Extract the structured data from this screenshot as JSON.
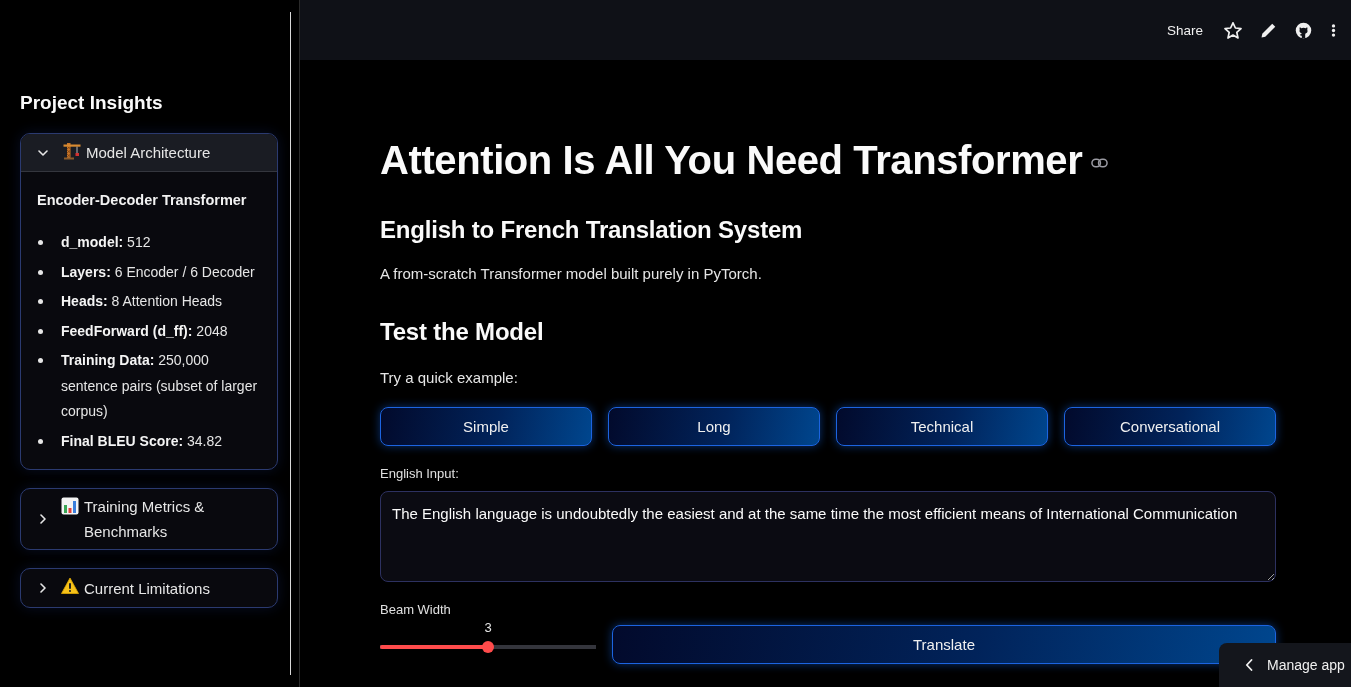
{
  "header": {
    "share": "Share"
  },
  "sidebar": {
    "title": "Project Insights",
    "expanders": [
      {
        "label": "Model Architecture",
        "expanded": true,
        "heading": "Encoder-Decoder Transformer",
        "items": [
          "**d_model:** 512",
          "**Layers:** 6 Encoder / 6 Decoder",
          "**Heads:** 8 Attention Heads",
          "**FeedForward (d_ff):** 2048",
          "**Training Data:** 250,000 sentence pairs (subset of larger corpus)",
          "**Final BLEU Score:** 34.82"
        ]
      },
      {
        "label": "Training Metrics & Benchmarks",
        "expanded": false
      },
      {
        "label": "Current Limitations",
        "expanded": false
      }
    ]
  },
  "main": {
    "title": "Attention Is All You Need Transformer",
    "subtitle": "English to French Translation System",
    "description": "A from-scratch Transformer model built purely in PyTorch.",
    "section_title": "Test the Model",
    "examples_label": "Try a quick example:",
    "examples": [
      "Simple",
      "Long",
      "Technical",
      "Conversational"
    ],
    "input": {
      "label": "English Input:",
      "value": "The English language is undoubtedly the easiest and at the same time the most efficient means of International Communication"
    },
    "beam_width": {
      "label": "Beam Width",
      "reading": "3",
      "level": 0.5
    },
    "translate_button": "Translate"
  },
  "manage_app": "Manage app"
}
